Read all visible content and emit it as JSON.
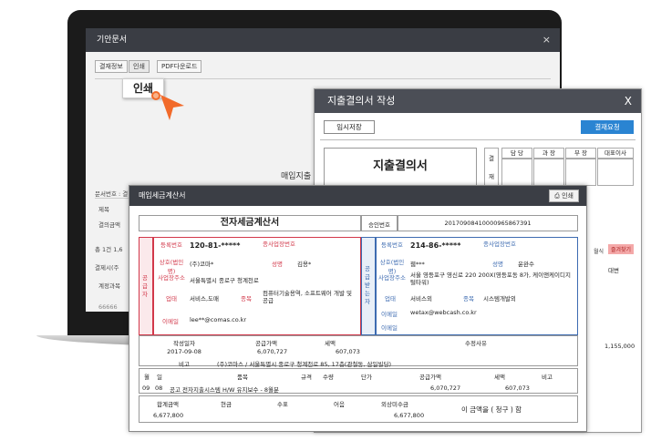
{
  "screen": {
    "title": "기안문서",
    "close": "×",
    "buttons": [
      "결재정보",
      "인쇄",
      "PDF다운로드"
    ],
    "callout": "인쇄",
    "bg_heading": "매입지출",
    "bg_labels": [
      "문서번호 : 결",
      "제목",
      "결의금액",
      "총 1건 1,6",
      "결제시(주",
      "계정과목",
      "66666"
    ],
    "right_values": [
      "월식",
      "대변",
      "1,155,000"
    ],
    "approve_badge": "즐겨찾기"
  },
  "expense": {
    "title": "지출결의서 작성",
    "close": "X",
    "save": "임시저장",
    "approve": "결재요청",
    "doc_title": "지출결의서",
    "side_label": [
      "결",
      "재"
    ],
    "approval_cols": [
      "담 당",
      "과 장",
      "부 장",
      "대표이사"
    ]
  },
  "invoice": {
    "window_title": "매입세금계산서",
    "print": "인쇄",
    "title": "전자세금계산서",
    "approval_no_label": "승인번호",
    "approval_no": "20170908410000965867391",
    "supplier": {
      "side": "공급자",
      "reg_label": "등록번호",
      "reg": "120-81-*****",
      "sub_label": "종사업장번호",
      "name_label": "상호(법인명)",
      "name": "(주)코마*",
      "rep_label": "성명",
      "rep": "김용*",
      "addr_label": "사업장주소",
      "addr": "서울특별시 종로구 청계천로",
      "biz_label": "업태",
      "biz": "서비스,도매",
      "item_label": "종목",
      "item": "컴퓨터기술용역, 소프트웨어 개발 및 공급",
      "email_label": "이메일",
      "email": "lee**@comas.co.kr"
    },
    "buyer": {
      "side": "공급받는자",
      "reg_label": "등록번호",
      "reg": "214-86-*****",
      "sub_label": "종사업장번호",
      "name_label": "상호(법인명)",
      "name": "웹***",
      "rep_label": "성명",
      "rep": "윤완수",
      "addr_label": "사업장주소",
      "addr": "서울 영등포구 영신로 220 200X(영등포동 8가, 케이앤케이디지털타워)",
      "biz_label": "업태",
      "biz": "서비스외",
      "item_label": "종목",
      "item": "시스템개발외",
      "email1_label": "이메일",
      "email1": "wetax@webcash.co.kr",
      "email2_label": "이메일",
      "email2": ""
    },
    "summary": {
      "date_label": "작성일자",
      "date": "2017-09-08",
      "supply_label": "공급가액",
      "supply": "6,070,727",
      "tax_label": "세액",
      "tax": "607,073",
      "edit_label": "수정사유",
      "note_label": "비고",
      "note": "(주)코마스 / 서울특별시 종로구 청계천로 85, 17층(관철동, 삼일빌딩)"
    },
    "items_header": [
      "월",
      "일",
      "품목",
      "규격",
      "수량",
      "단가",
      "공급가액",
      "세액",
      "비고"
    ],
    "item_row": [
      "09",
      "08",
      "공고 전자지출시스템 H/W 유지보수 - 8월분",
      "",
      "",
      "",
      "6,070,727",
      "607,073",
      ""
    ],
    "totals_header": [
      "합계금액",
      "현금",
      "수표",
      "어음",
      "외상미수금"
    ],
    "totals": [
      "6,677,800",
      "",
      "",
      "",
      "6,677,800"
    ],
    "claim": "이 금액을 ( 청구 ) 함"
  }
}
